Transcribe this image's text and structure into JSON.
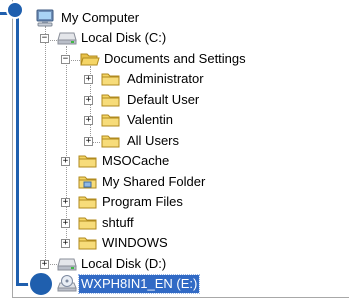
{
  "tree": {
    "items": [
      {
        "label": "My Computer",
        "icon": "computer-icon",
        "expander": ""
      },
      {
        "label": "Local Disk (C:)",
        "icon": "drive-icon",
        "expander": "−"
      },
      {
        "label": "Documents and Settings",
        "icon": "folder-open-icon",
        "expander": "−"
      },
      {
        "label": "Administrator",
        "icon": "folder-icon",
        "expander": "+"
      },
      {
        "label": "Default User",
        "icon": "folder-icon",
        "expander": "+"
      },
      {
        "label": "Valentin",
        "icon": "folder-icon",
        "expander": "+"
      },
      {
        "label": "All Users",
        "icon": "folder-icon",
        "expander": "+"
      },
      {
        "label": "MSOCache",
        "icon": "folder-icon",
        "expander": "+"
      },
      {
        "label": "My Shared Folder",
        "icon": "shared-folder-icon",
        "expander": ""
      },
      {
        "label": "Program Files",
        "icon": "folder-icon",
        "expander": "+"
      },
      {
        "label": "shtuff",
        "icon": "folder-icon",
        "expander": "+"
      },
      {
        "label": "WINDOWS",
        "icon": "folder-icon",
        "expander": "+"
      },
      {
        "label": "Local Disk (D:)",
        "icon": "drive-icon",
        "expander": "+"
      },
      {
        "label": "WXPH8IN1_EN (E:)",
        "icon": "cd-drive-icon",
        "expander": "",
        "selected": true
      }
    ]
  },
  "colors": {
    "selection": "#316ac5",
    "callout": "#1f5fae",
    "folder": "#f5d566"
  }
}
